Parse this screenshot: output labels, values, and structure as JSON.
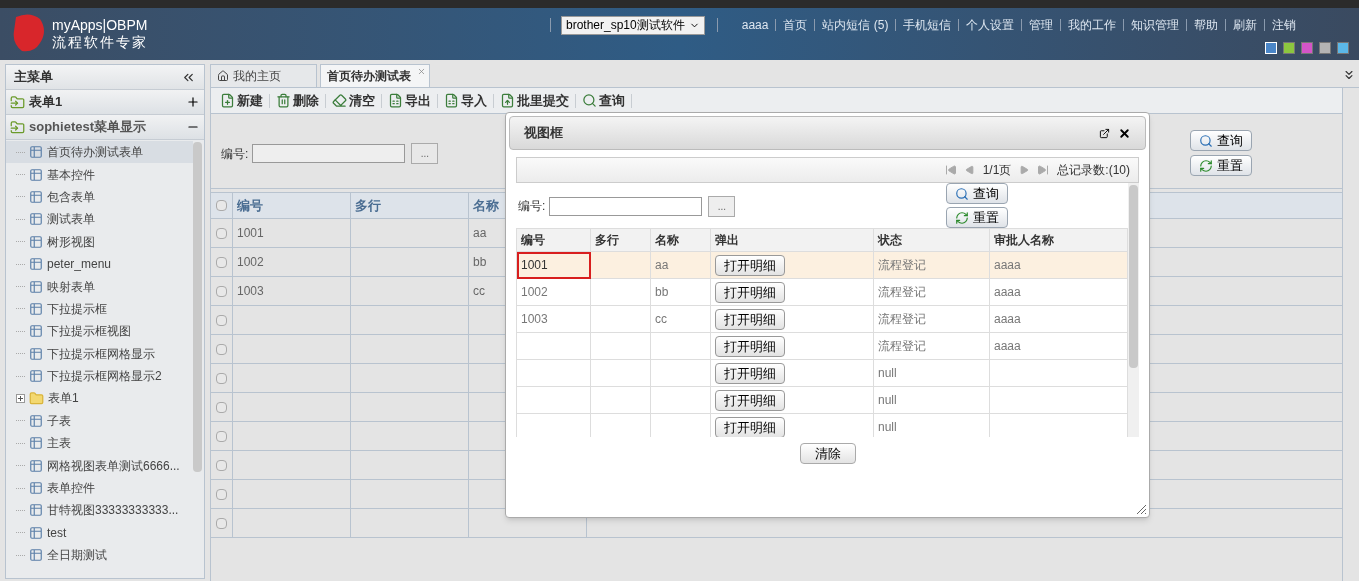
{
  "header": {
    "brand": "myApps|OBPM",
    "tagline": "流程软件专家",
    "app_select": "brother_sp10测试软件",
    "nav": [
      "aaaa",
      "首页",
      "站内短信 (5)",
      "手机短信",
      "个人设置",
      "管理",
      "我的工作",
      "知识管理",
      "帮助",
      "刷新",
      "注销"
    ],
    "themes": [
      {
        "color": "#4a86c8",
        "selected": true
      },
      {
        "color": "#8cc63f",
        "selected": false
      },
      {
        "color": "#d455c8",
        "selected": false
      },
      {
        "color": "#b4b4b4",
        "selected": false
      },
      {
        "color": "#5bb8e8",
        "selected": false
      }
    ]
  },
  "sidebar": {
    "title": "主菜单",
    "sections": [
      {
        "label": "表单1",
        "expanded": false
      },
      {
        "label": "sophietest菜单显示",
        "expanded": true
      }
    ],
    "items": [
      {
        "label": "首页待办测试表单",
        "kind": "form",
        "selected": true
      },
      {
        "label": "基本控件",
        "kind": "form",
        "selected": false
      },
      {
        "label": "包含表单",
        "kind": "form",
        "selected": false
      },
      {
        "label": "测试表单",
        "kind": "form",
        "selected": false
      },
      {
        "label": "树形视图",
        "kind": "form",
        "selected": false
      },
      {
        "label": "peter_menu",
        "kind": "form",
        "selected": false
      },
      {
        "label": "映射表单",
        "kind": "form",
        "selected": false
      },
      {
        "label": "下拉提示框",
        "kind": "form",
        "selected": false
      },
      {
        "label": "下拉提示框视图",
        "kind": "form",
        "selected": false
      },
      {
        "label": "下拉提示框网格显示",
        "kind": "form",
        "selected": false
      },
      {
        "label": "下拉提示框网格显示2",
        "kind": "form",
        "selected": false
      },
      {
        "label": "表单1",
        "kind": "folder",
        "selected": false,
        "expanded": false
      },
      {
        "label": "子表",
        "kind": "form",
        "selected": false
      },
      {
        "label": "主表",
        "kind": "form",
        "selected": false
      },
      {
        "label": "网格视图表单测试6666...",
        "kind": "form",
        "selected": false
      },
      {
        "label": "表单控件",
        "kind": "form",
        "selected": false
      },
      {
        "label": "甘特视图33333333333...",
        "kind": "form",
        "selected": false
      },
      {
        "label": "test",
        "kind": "form",
        "selected": false
      },
      {
        "label": "全日期测试",
        "kind": "form",
        "selected": false
      }
    ]
  },
  "tabs": [
    {
      "label": "我的主页",
      "selected": false,
      "kind": "home"
    },
    {
      "label": "首页待办测试表",
      "selected": true,
      "kind": "closable"
    }
  ],
  "toolbar": [
    {
      "label": "新建",
      "kind": "new"
    },
    {
      "label": "删除",
      "kind": "delete"
    },
    {
      "label": "清空",
      "kind": "clear"
    },
    {
      "label": "导出",
      "kind": "export"
    },
    {
      "label": "导入",
      "kind": "import"
    },
    {
      "label": "批里提交",
      "kind": "submit"
    },
    {
      "label": "查询",
      "kind": "search"
    }
  ],
  "search": {
    "label": "编号:",
    "browse": "...",
    "query": "查询",
    "reset": "重置"
  },
  "table": {
    "all_checked": false,
    "columns": [
      "编号",
      "多行",
      "名称"
    ],
    "rows": [
      {
        "cells": [
          "1001",
          "",
          "aa"
        ],
        "checked": false
      },
      {
        "cells": [
          "1002",
          "",
          "bb"
        ],
        "checked": false
      },
      {
        "cells": [
          "1003",
          "",
          "cc"
        ],
        "checked": false
      },
      {
        "cells": [
          "",
          "",
          ""
        ],
        "checked": false
      },
      {
        "cells": [
          "",
          "",
          ""
        ],
        "checked": false
      },
      {
        "cells": [
          "",
          "",
          ""
        ],
        "checked": false
      },
      {
        "cells": [
          "",
          "",
          ""
        ],
        "checked": false
      },
      {
        "cells": [
          "",
          "",
          ""
        ],
        "checked": false
      },
      {
        "cells": [
          "",
          "",
          ""
        ],
        "checked": false
      },
      {
        "cells": [
          "",
          "",
          ""
        ],
        "checked": false
      },
      {
        "cells": [
          "",
          "",
          ""
        ],
        "checked": false
      }
    ]
  },
  "dialog": {
    "title": "视图框",
    "pager": "1/1页",
    "total": "总记录数:(10)",
    "search": {
      "label": "编号:",
      "browse": "...",
      "query": "查询",
      "reset": "重置"
    },
    "columns": [
      "编号",
      "多行",
      "名称",
      "弹出",
      "状态",
      "审批人名称"
    ],
    "rows": [
      {
        "cells": [
          "1001",
          "",
          "aa",
          "打开明细",
          "流程登记",
          "aaaa"
        ],
        "selected": true
      },
      {
        "cells": [
          "1002",
          "",
          "bb",
          "打开明细",
          "流程登记",
          "aaaa"
        ],
        "selected": false
      },
      {
        "cells": [
          "1003",
          "",
          "cc",
          "打开明细",
          "流程登记",
          "aaaa"
        ],
        "selected": false
      },
      {
        "cells": [
          "",
          "",
          "",
          "打开明细",
          "流程登记",
          "aaaa"
        ],
        "selected": false
      },
      {
        "cells": [
          "",
          "",
          "",
          "打开明细",
          "null",
          ""
        ],
        "selected": false
      },
      {
        "cells": [
          "",
          "",
          "",
          "打开明细",
          "null",
          ""
        ],
        "selected": false
      },
      {
        "cells": [
          "",
          "",
          "",
          "打开明细",
          "null",
          ""
        ],
        "selected": false
      }
    ],
    "clear": "清除"
  }
}
